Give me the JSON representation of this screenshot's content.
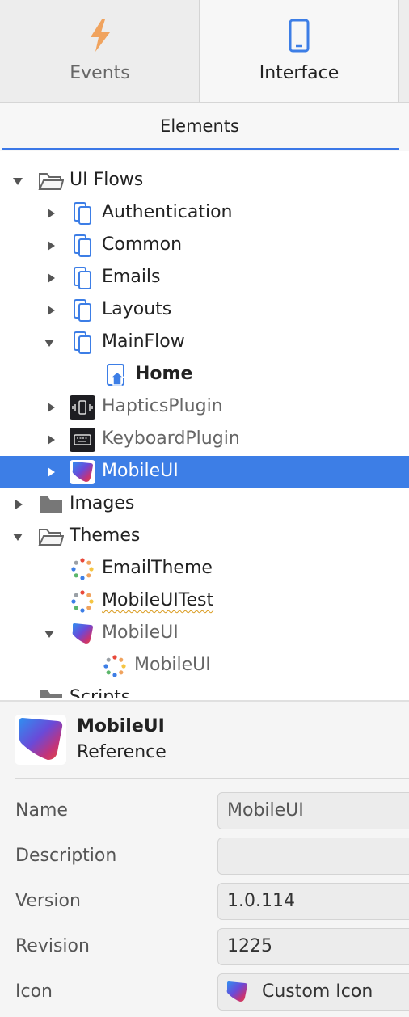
{
  "top_tabs": {
    "events": {
      "label": "Events",
      "icon": "lightning-icon"
    },
    "interface": {
      "label": "Interface",
      "icon": "mobile-device-icon"
    }
  },
  "subtab": {
    "label": "Elements"
  },
  "tree": {
    "ui_flows": {
      "label": "UI Flows",
      "icon": "folder-open-icon"
    },
    "authentication": {
      "label": "Authentication",
      "icon": "ui-flow-icon"
    },
    "common": {
      "label": "Common",
      "icon": "ui-flow-icon"
    },
    "emails": {
      "label": "Emails",
      "icon": "ui-flow-icon"
    },
    "layouts": {
      "label": "Layouts",
      "icon": "ui-flow-icon"
    },
    "mainflow": {
      "label": "MainFlow",
      "icon": "ui-flow-icon"
    },
    "home": {
      "label": "Home",
      "icon": "home-screen-icon"
    },
    "haptics": {
      "label": "HapticsPlugin",
      "icon": "haptics-plugin-icon"
    },
    "keyboard": {
      "label": "KeyboardPlugin",
      "icon": "keyboard-plugin-icon"
    },
    "mobileui": {
      "label": "MobileUI",
      "icon": "mobileui-logo-icon"
    },
    "images": {
      "label": "Images",
      "icon": "folder-icon"
    },
    "themes": {
      "label": "Themes",
      "icon": "folder-open-icon"
    },
    "emailtheme": {
      "label": "EmailTheme",
      "icon": "theme-icon"
    },
    "mobileuitest": {
      "label": "MobileUITest",
      "icon": "theme-icon"
    },
    "mobileui_ref": {
      "label": "MobileUI",
      "icon": "mobileui-logo-icon"
    },
    "mobileui_theme": {
      "label": "MobileUI",
      "icon": "theme-icon"
    },
    "scripts": {
      "label": "Scripts",
      "icon": "folder-icon"
    }
  },
  "properties": {
    "title": "MobileUI",
    "subtitle": "Reference",
    "fields": {
      "name": {
        "label": "Name",
        "value": "MobileUI"
      },
      "description": {
        "label": "Description",
        "value": ""
      },
      "version": {
        "label": "Version",
        "value": "1.0.114"
      },
      "revision": {
        "label": "Revision",
        "value": "1225"
      },
      "icon": {
        "label": "Icon",
        "value": "Custom Icon"
      }
    }
  },
  "colors": {
    "accent": "#3d7ee6",
    "lightning": "#f0a35e",
    "selection": "#3d7ee6"
  }
}
